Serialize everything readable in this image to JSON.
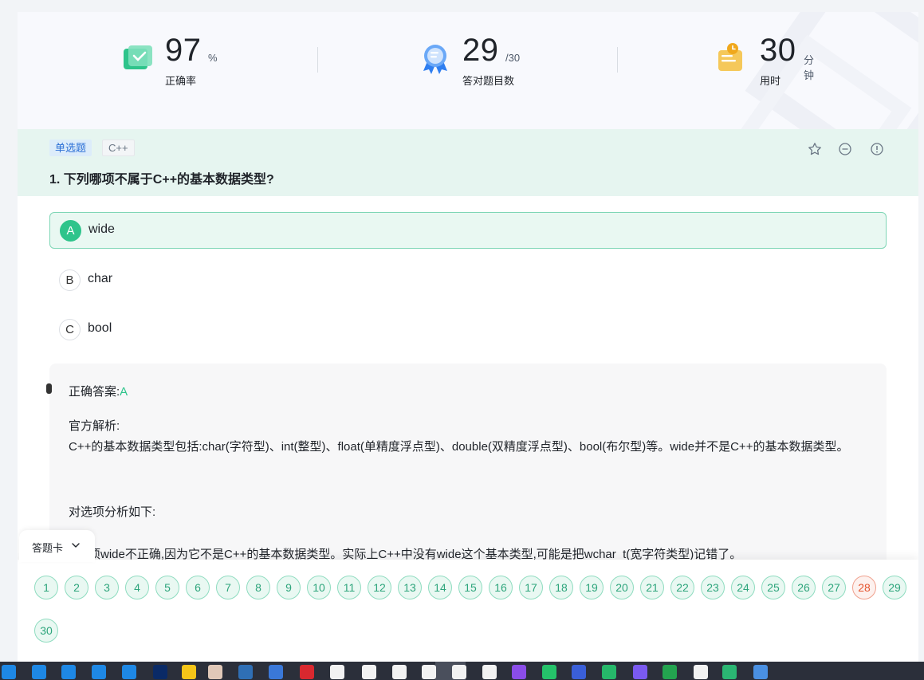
{
  "stats": {
    "accuracy": {
      "value": "97",
      "unit": "%",
      "label": "正确率"
    },
    "correct": {
      "value": "29",
      "unit": "/30",
      "label": "答对题目数"
    },
    "time": {
      "value": "30",
      "unit": "分钟",
      "label": "用时"
    }
  },
  "question": {
    "type_tag": "单选题",
    "lang_tag": "C++",
    "title": "1. 下列哪项不属于C++的基本数据类型?",
    "actions": [
      "star-icon",
      "minus-circle-icon",
      "alert-circle-icon"
    ]
  },
  "options": [
    {
      "letter": "A",
      "text": "wide",
      "selected": true
    },
    {
      "letter": "B",
      "text": "char",
      "selected": false
    },
    {
      "letter": "C",
      "text": "bool",
      "selected": false
    }
  ],
  "analysis": {
    "answer_label": "正确答案:",
    "answer_value": "A",
    "explanation_label": "官方解析:",
    "explanation_text": "C++的基本数据类型包括:char(字符型)、int(整型)、float(单精度浮点型)、double(双精度浮点型)、bool(布尔型)等。wide并不是C++的基本数据类型。",
    "sub_label": "对选项分析如下:",
    "sub_text": "A选项wide不正确,因为它不是C++的基本数据类型。实际上C++中没有wide这个基本类型,可能是把wchar_t(宽字符类型)记错了。"
  },
  "answer_card": {
    "tab_label": "答题卡",
    "numbers": [
      "1",
      "2",
      "3",
      "4",
      "5",
      "6",
      "7",
      "8",
      "9",
      "10",
      "11",
      "12",
      "13",
      "14",
      "15",
      "16",
      "17",
      "18",
      "19",
      "20",
      "21",
      "22",
      "23",
      "24",
      "25",
      "26",
      "27",
      "28",
      "29",
      "30"
    ],
    "wrong": [
      "28"
    ]
  },
  "colors": {
    "accent_green": "#2ec48b",
    "header_green_bg": "#e6f5f0",
    "wrong_red": "#e5552f"
  }
}
